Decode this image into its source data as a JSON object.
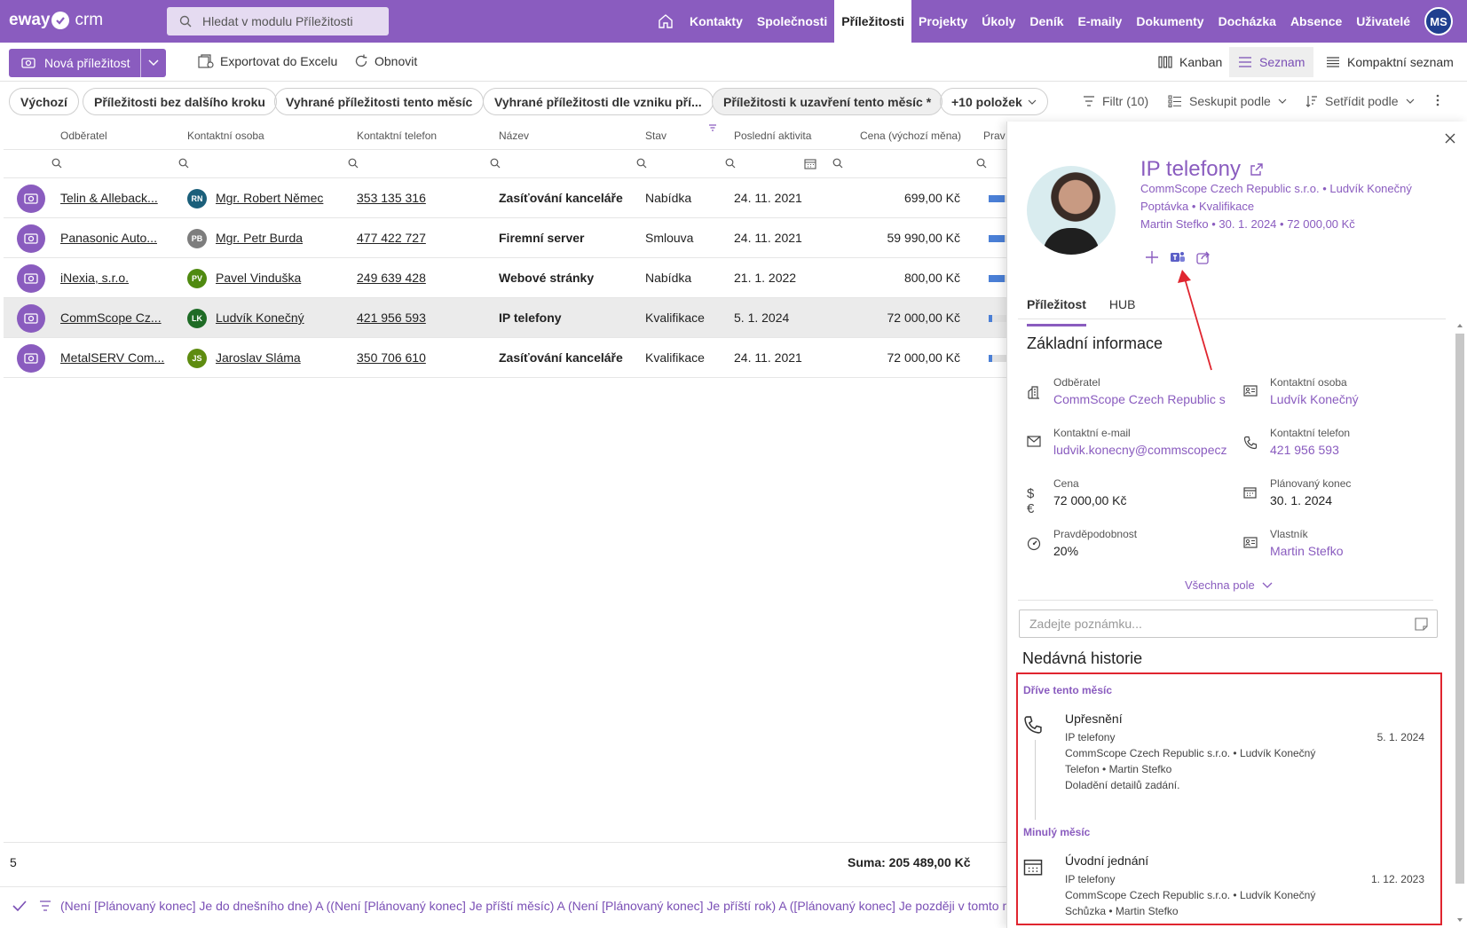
{
  "app": {
    "logo_left": "eway",
    "logo_right": "crm"
  },
  "search": {
    "placeholder": "Hledat v modulu Příležitosti"
  },
  "nav": {
    "items": [
      "Kontakty",
      "Společnosti",
      "Příležitosti",
      "Projekty",
      "Úkoly",
      "Deník",
      "E-maily",
      "Dokumenty",
      "Docházka",
      "Absence",
      "Uživatelé"
    ],
    "active": "Příležitosti",
    "user_initials": "MS"
  },
  "toolbar": {
    "new_label": "Nová příležitost",
    "export_label": "Exportovat do Excelu",
    "refresh_label": "Obnovit",
    "kanban_label": "Kanban",
    "list_label": "Seznam",
    "compact_label": "Kompaktní seznam"
  },
  "filters": {
    "chips": [
      "Výchozí",
      "Příležitosti bez dalšího kroku",
      "Vyhrané příležitosti tento měsíc",
      "Vyhrané příležitosti dle vzniku pří...",
      "Příležitosti k uzavření tento měsíc *",
      "+10 položek"
    ],
    "filter_label": "Filtr (10)",
    "group_label": "Seskupit podle",
    "sort_label": "Setřídit podle"
  },
  "grid": {
    "columns": [
      "Odběratel",
      "Kontaktní osoba",
      "Kontaktní telefon",
      "Název",
      "Stav",
      "Poslední aktivita",
      "Cena (výchozí měna)",
      "Prav"
    ],
    "rows": [
      {
        "customer": "Telin & Alleback...",
        "initials": "RN",
        "avatar_color": "#1b5f7a",
        "contact": "Mgr. Robert Němec",
        "phone": "353 135 316",
        "name": "Zasíťování kanceláře",
        "state": "Nabídka",
        "last": "24. 11. 2021",
        "price": "699,00 Kč",
        "prob": 0.9
      },
      {
        "customer": "Panasonic Auto...",
        "initials": "PB",
        "avatar_color": "#7d7d7d",
        "contact": "Mgr. Petr Burda",
        "phone": "477 422 727",
        "name": "Firemní server",
        "state": "Smlouva",
        "last": "24. 11. 2021",
        "price": "59 990,00 Kč",
        "prob": 0.9
      },
      {
        "customer": "iNexia, s.r.o.",
        "initials": "PV",
        "avatar_color": "#4f8a10",
        "contact": "Pavel Vinduška",
        "phone": "249 639 428",
        "name": "Webové stránky",
        "state": "Nabídka",
        "last": "21. 1. 2022",
        "price": "800,00 Kč",
        "prob": 0.9
      },
      {
        "customer": "CommScope Cz...",
        "initials": "LK",
        "avatar_color": "#1e6b25",
        "contact": "Ludvík Konečný",
        "phone": "421 956 593",
        "name": "IP telefony",
        "state": "Kvalifikace",
        "last": "5. 1. 2024",
        "price": "72 000,00 Kč",
        "prob": 0.2
      },
      {
        "customer": "MetalSERV Com...",
        "initials": "JS",
        "avatar_color": "#5e8c10",
        "contact": "Jaroslav Sláma",
        "phone": "350 706 610",
        "name": "Zasíťování kanceláře",
        "state": "Kvalifikace",
        "last": "24. 11. 2021",
        "price": "72 000,00 Kč",
        "prob": 0.2
      }
    ],
    "count": "5",
    "sum": "Suma: 205 489,00 Kč",
    "filter_text": "(Není [Plánovaný konec] Je do dnešního dne) A ((Není [Plánovaný konec] Je příští měsíc) A (Není [Plánovaný konec] Je příští rok) A ([Plánovaný konec] Je později v tomto mě"
  },
  "detail": {
    "title": "IP telefony",
    "meta1": "CommScope Czech Republic s.r.o. • Ludvík Konečný",
    "meta2": "Poptávka • Kvalifikace",
    "meta3": "Martin Stefko • 30. 1. 2024 • 72 000,00 Kč",
    "tabs": [
      "Příležitost",
      "HUB"
    ],
    "section": "Základní informace",
    "fields": {
      "customer_label": "Odběratel",
      "customer": "CommScope Czech Republic s.r.o.",
      "contact_label": "Kontaktní osoba",
      "contact": "Ludvík Konečný",
      "email_label": "Kontaktní e-mail",
      "email": "ludvik.konecny@commscopeczech.cz",
      "phone_label": "Kontaktní telefon",
      "phone": "421 956 593",
      "price_label": "Cena",
      "price": "72 000,00 Kč",
      "end_label": "Plánovaný konec",
      "end": "30. 1. 2024",
      "prob_label": "Pravděpodobnost",
      "prob": "20%",
      "owner_label": "Vlastník",
      "owner": "Martin Stefko"
    },
    "all_fields": "Všechna pole",
    "note_placeholder": "Zadejte poznámku...",
    "history_title": "Nedávná historie",
    "history": [
      {
        "group": "Dříve tento měsíc",
        "title": "Upřesnění",
        "lines": [
          "IP telefony",
          "CommScope Czech Republic s.r.o. • Ludvík Konečný",
          "Telefon • Martin Stefko",
          "Doladění detailů zadání."
        ],
        "date": "5. 1. 2024"
      },
      {
        "group": "Minulý měsíc",
        "title": "Úvodní jednání",
        "lines": [
          "IP telefony",
          "CommScope Czech Republic s.r.o. • Ludvík Konečný",
          "Schůzka • Martin Stefko"
        ],
        "date": "1. 12. 2023"
      }
    ]
  },
  "colors": {
    "brand": "#8a5cbf",
    "highlight": "#e0252f"
  }
}
